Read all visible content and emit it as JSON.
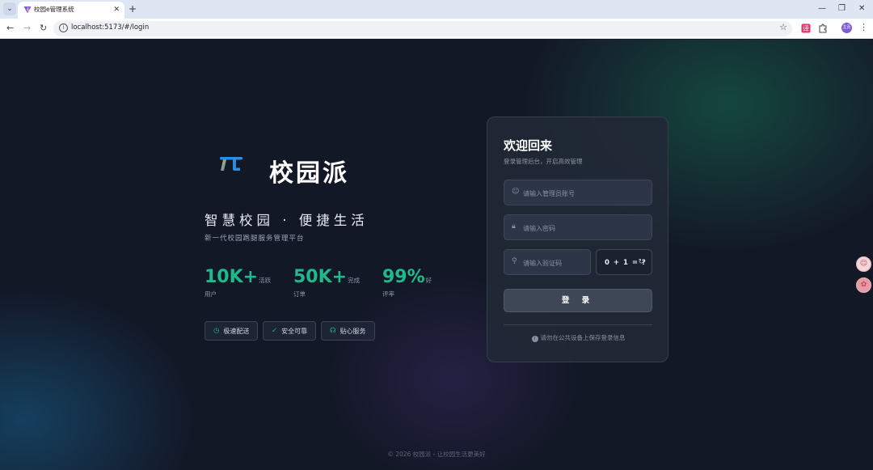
{
  "browser": {
    "tab_title": "校园e管理系统",
    "tab_menu_icon": "chevron-down-icon",
    "close_icon": "close-icon",
    "new_tab_icon": "plus-icon",
    "url": "localhost:5173/#/login",
    "nav": {
      "back_icon": "arrow-left-icon",
      "forward_icon": "arrow-right-icon",
      "reload_icon": "reload-icon"
    },
    "window": {
      "minimize_icon": "minimize-icon",
      "restore_icon": "restore-icon",
      "close_icon": "close-icon"
    },
    "profile_label": "主页"
  },
  "brand": {
    "logo_icon": "campus-logo-icon",
    "name": "校园派",
    "slogan": "智慧校园 · 便捷生活",
    "subtitle": "新一代校园跑腿服务管理平台"
  },
  "stats": [
    {
      "value": "10K+",
      "suffix": "活跃",
      "label": "用户"
    },
    {
      "value": "50K+",
      "suffix": "完成",
      "label": "订单"
    },
    {
      "value": "99%",
      "suffix": "好",
      "label": "评率"
    }
  ],
  "features": [
    {
      "icon": "timer-icon",
      "label": "极速配送"
    },
    {
      "icon": "check-circle-icon",
      "label": "安全可靠"
    },
    {
      "icon": "headset-icon",
      "label": "贴心服务"
    }
  ],
  "login": {
    "title": "欢迎回来",
    "subtitle": "登录管理后台，开启高效管理",
    "username_placeholder": "请输入管理员账号",
    "password_placeholder": "请输入密码",
    "captcha_placeholder": "请输入验证码",
    "captcha_question": "0 + 1 = ?",
    "submit_label": "登 录",
    "note": "请勿在公共设备上保存登录信息"
  },
  "footer": "© 2026 校园派 - 让校园生活更美好",
  "colors": {
    "accent": "#20b98b",
    "background": "#131827",
    "card": "#212936"
  }
}
